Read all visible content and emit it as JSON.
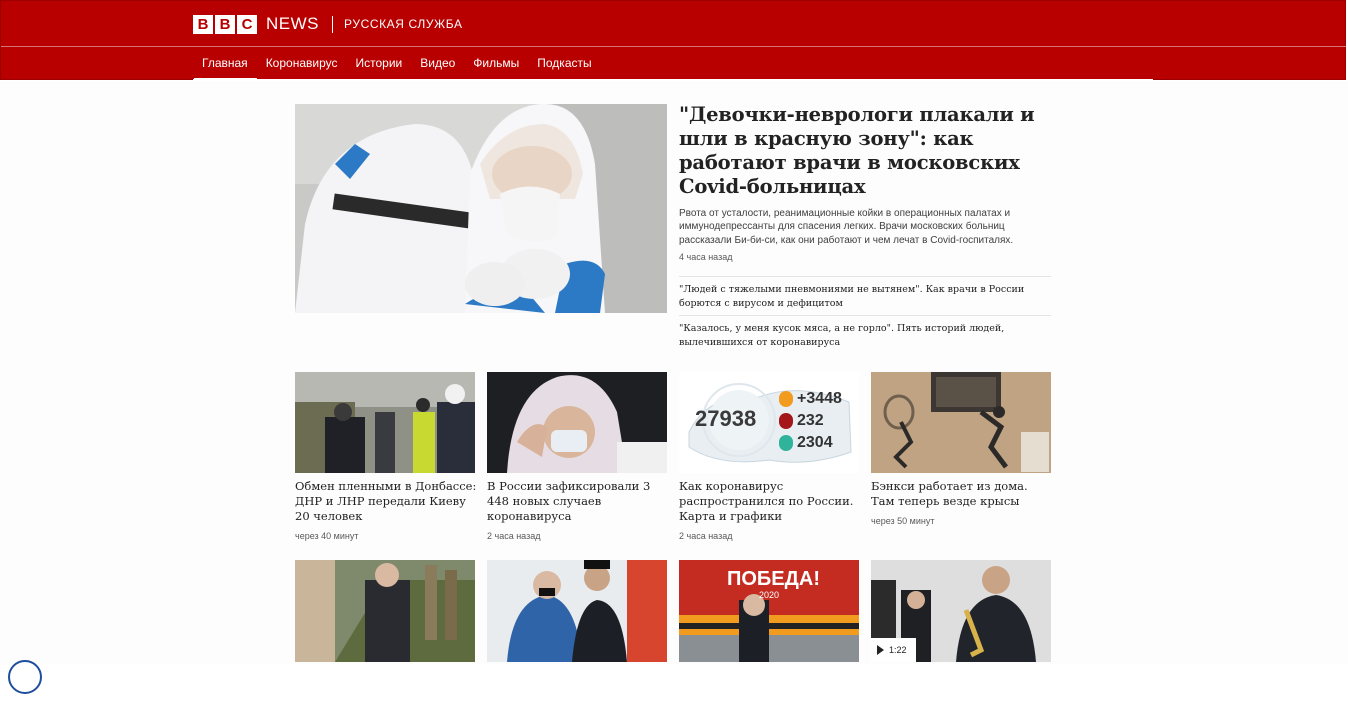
{
  "header": {
    "logo_letters": [
      "B",
      "B",
      "C"
    ],
    "news_label": "NEWS",
    "service_label": "РУССКАЯ СЛУЖБА"
  },
  "nav": {
    "items": [
      {
        "label": "Главная",
        "active": true
      },
      {
        "label": "Коронавирус",
        "active": false
      },
      {
        "label": "Истории",
        "active": false
      },
      {
        "label": "Видео",
        "active": false
      },
      {
        "label": "Фильмы",
        "active": false
      },
      {
        "label": "Подкасты",
        "active": false
      }
    ]
  },
  "lead": {
    "title": "\"Девочки-неврологи плакали и шли в красную зону\": как работают врачи в московских Covid-больницах",
    "summary": "Рвота от усталости, реанимационные койки в операционных палатах и иммунодепрессанты для спасения легких. Врачи московских больниц рассказали Би-би-си, как они работают и чем лечат в Covid-госпиталях.",
    "time": "4 часа назад",
    "related": [
      "\"Людей с тяжелыми пневмониями не вытянем\". Как врачи в России борются с вирусом и дефицитом",
      "\"Казалось, у меня кусок мяса, а не горло\". Пять историй людей, вылечившихся от коронавируса"
    ]
  },
  "cards": [
    {
      "title": "Обмен пленными в Донбассе: ДНР и ЛНР передали Киеву 20 человек",
      "time": "через 40 минут"
    },
    {
      "title": "В России зафиксировали 3 448 новых случаев коронавируса",
      "time": "2 часа назад"
    },
    {
      "title": "Как коронавирус распространился по России. Карта и графики",
      "time": "2 часа назад"
    },
    {
      "title": "Бэнкси работает из дома. Там теперь везде крысы",
      "time": "через 50 минут"
    }
  ],
  "stats_image": {
    "total": "27938",
    "new_cases": "+3448",
    "deaths": "232",
    "recovered": "2304"
  },
  "poster_text": {
    "word": "ПОБЕДА!",
    "year": "2020"
  },
  "video_badge": {
    "duration": "1:22"
  },
  "colors": {
    "brand_red": "#b80000",
    "stat_orange": "#f29c1f",
    "stat_red": "#a4161a",
    "stat_green": "#2fb39a"
  }
}
